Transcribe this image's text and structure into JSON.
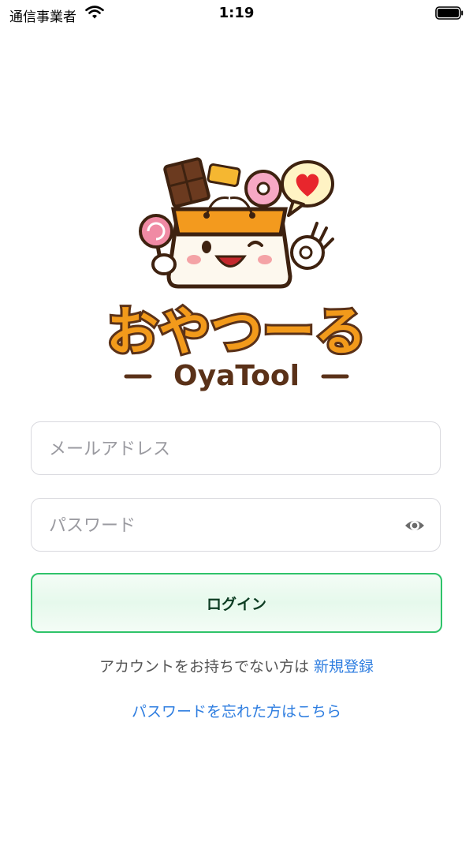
{
  "status_bar": {
    "carrier": "通信事業者",
    "time": "1:19"
  },
  "logo": {
    "title_jp": "おやつーる",
    "title_en": "OyaTool"
  },
  "login_form": {
    "email_placeholder": "メールアドレス",
    "password_placeholder": "パスワード",
    "login_label": "ログイン"
  },
  "footer": {
    "signup_prompt": "アカウントをお持ちでない方は",
    "signup_link": "新規登録",
    "forgot_password": "パスワードを忘れた方はこちら"
  },
  "colors": {
    "accent_green": "#2fc36a",
    "link_blue": "#2f7ee0",
    "logo_orange": "#f29a1b",
    "logo_brown": "#5a3118"
  }
}
